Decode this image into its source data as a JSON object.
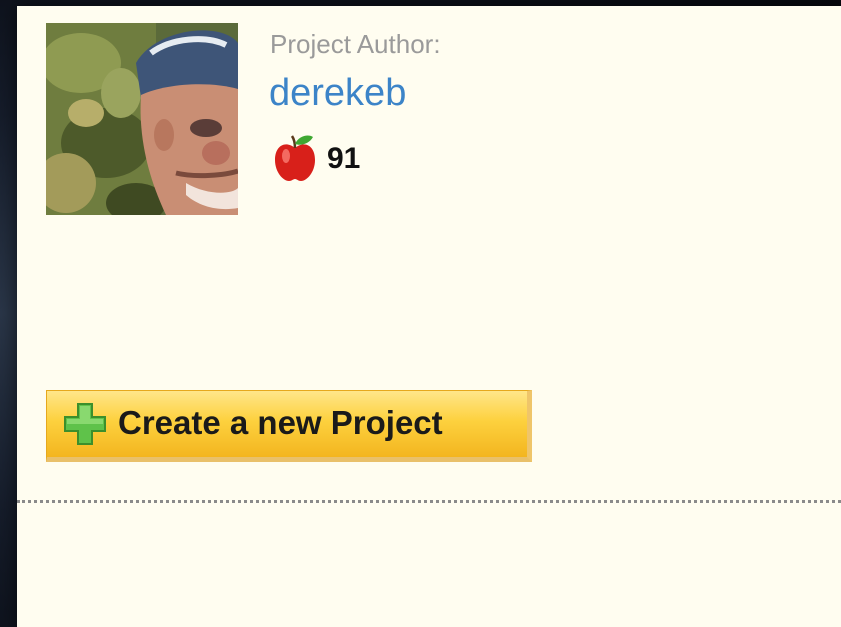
{
  "author": {
    "label": "Project Author:",
    "username": "derekeb",
    "score": "91",
    "score_icon": "apple-icon",
    "avatar_icon": "avatar-photo"
  },
  "actions": {
    "create_label": "Create a new Project",
    "create_icon": "plus-icon"
  },
  "colors": {
    "background": "#fffdf0",
    "link": "#3c84c8",
    "label": "#9a9a9a",
    "button": "#fdd13e"
  }
}
